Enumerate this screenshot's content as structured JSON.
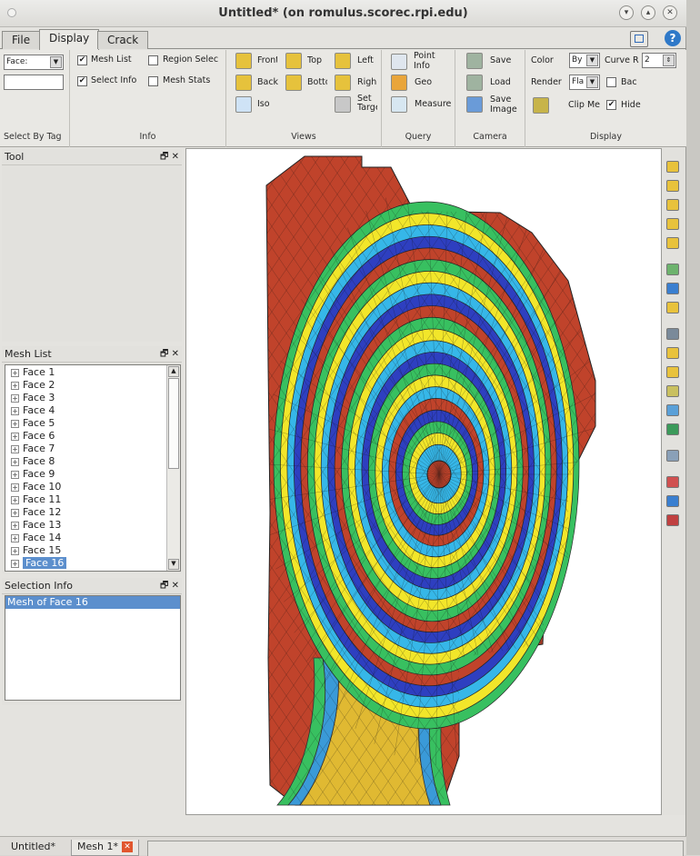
{
  "window": {
    "title": "Untitled* (on romulus.scorec.rpi.edu)"
  },
  "menu_tabs": [
    "File",
    "Display",
    "Crack"
  ],
  "ribbon": {
    "select_by_tag": {
      "combo_value": "Face:",
      "input_value": "",
      "label": "Select By Tag"
    },
    "info": {
      "mesh_list": "Mesh List",
      "region_select": "Region Selec",
      "select_info": "Select Info",
      "mesh_stats": "Mesh Stats",
      "label": "Info"
    },
    "views": {
      "front": "Front",
      "top": "Top",
      "left": "Left",
      "back": "Back",
      "bottom": "Botto",
      "right": "Righ",
      "iso": "Iso",
      "set_target": "Set Targe",
      "label": "Views"
    },
    "query": {
      "point_info": "Point Info",
      "geo": "Geo",
      "measure": "Measure",
      "label": "Query"
    },
    "camera": {
      "save": "Save",
      "load": "Load",
      "save_image": "Save Image",
      "label": "Camera"
    },
    "display": {
      "color": "Color",
      "color_value": "By",
      "curve": "Curve R",
      "curve_value": "2",
      "render": "Render",
      "render_value": "Fla",
      "back": "Bac",
      "clip": "Clip Me",
      "hide": "Hide",
      "label": "Display"
    }
  },
  "tool_panel": {
    "title": "Tool"
  },
  "mesh_list": {
    "title": "Mesh List",
    "items": [
      "Face 1",
      "Face 2",
      "Face 3",
      "Face 4",
      "Face 5",
      "Face 6",
      "Face 7",
      "Face 8",
      "Face 9",
      "Face 10",
      "Face 11",
      "Face 12",
      "Face 13",
      "Face 14",
      "Face 15",
      "Face 16"
    ],
    "selected": "Face 16"
  },
  "selection_info": {
    "title": "Selection Info",
    "value": "Mesh of Face 16"
  },
  "bottom_tabs": [
    "Untitled*",
    "Mesh 1*"
  ],
  "colors": {
    "outer": "#c0432b",
    "ring_palette": [
      "#c0432b",
      "#2e3fc0",
      "#36b7e8",
      "#38c060",
      "#f2e62a",
      "#3a8ce0"
    ]
  }
}
